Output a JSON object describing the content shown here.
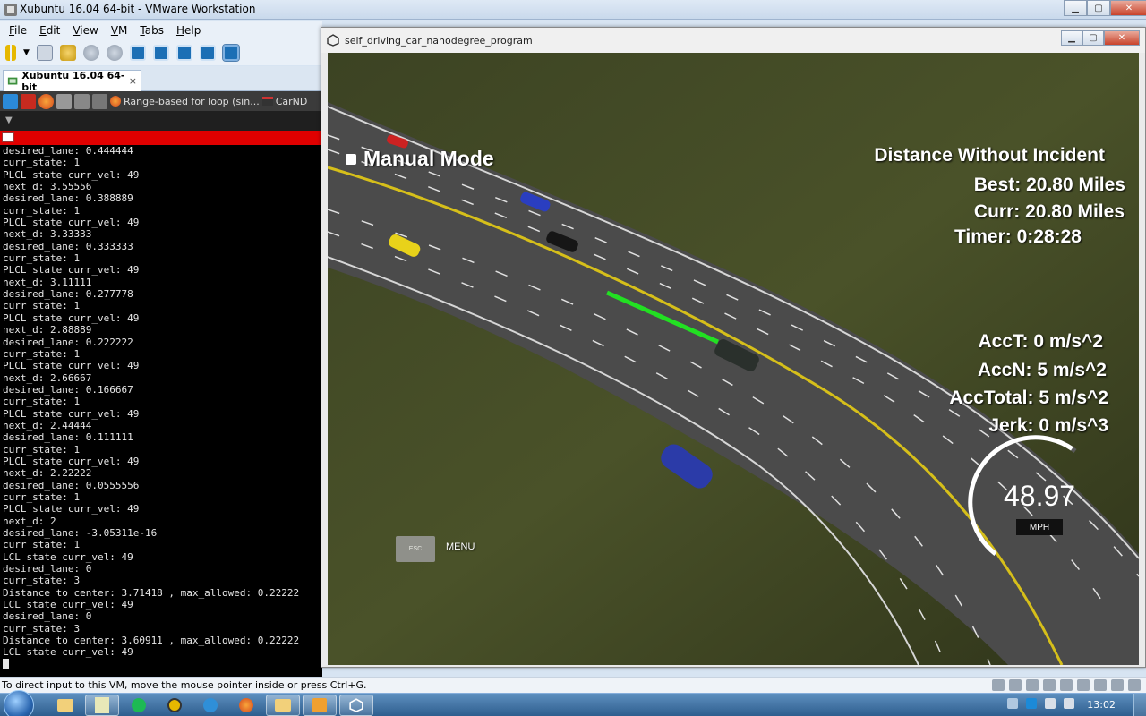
{
  "vmware": {
    "title": "Xubuntu 16.04 64-bit - VMware Workstation",
    "menu": [
      "File",
      "Edit",
      "View",
      "VM",
      "Tabs",
      "Help"
    ],
    "tab_label": "Xubuntu 16.04 64-bit",
    "tab_close": "×",
    "status_hint": "To direct input to this VM, move the mouse pointer inside or press Ctrl+G."
  },
  "guest_panel": {
    "tasks": [
      "Range-based for loop (sin...",
      "CarND"
    ]
  },
  "terminal": {
    "lines": [
      "desired_lane: 0.444444",
      "curr_state: 1",
      "PLCL state curr_vel: 49",
      "next_d: 3.55556",
      "desired_lane: 0.388889",
      "curr_state: 1",
      "PLCL state curr_vel: 49",
      "next_d: 3.33333",
      "desired_lane: 0.333333",
      "curr_state: 1",
      "PLCL state curr_vel: 49",
      "next_d: 3.11111",
      "desired_lane: 0.277778",
      "curr_state: 1",
      "PLCL state curr_vel: 49",
      "next_d: 2.88889",
      "desired_lane: 0.222222",
      "curr_state: 1",
      "PLCL state curr_vel: 49",
      "next_d: 2.66667",
      "desired_lane: 0.166667",
      "curr_state: 1",
      "PLCL state curr_vel: 49",
      "next_d: 2.44444",
      "desired_lane: 0.111111",
      "curr_state: 1",
      "PLCL state curr_vel: 49",
      "next_d: 2.22222",
      "desired_lane: 0.0555556",
      "curr_state: 1",
      "PLCL state curr_vel: 49",
      "next_d: 2",
      "desired_lane: -3.05311e-16",
      "curr_state: 1",
      "LCL state curr_vel: 49",
      "desired_lane: 0",
      "curr_state: 3",
      "Distance to center: 3.71418 , max_allowed: 0.22222",
      "LCL state curr_vel: 49",
      "desired_lane: 0",
      "curr_state: 3",
      "Distance to center: 3.60911 , max_allowed: 0.22222",
      "LCL state curr_vel: 49"
    ]
  },
  "simulator": {
    "title": "self_driving_car_nanodegree_program",
    "manual_mode": "Manual Mode",
    "distance_title": "Distance Without Incident",
    "best": "Best: 20.80 Miles",
    "curr": "Curr: 20.80 Miles",
    "timer": "Timer: 0:28:28",
    "acc_t": "AccT: 0 m/s^2",
    "acc_n": "AccN: 5 m/s^2",
    "acc_total": "AccTotal: 5 m/s^2",
    "jerk": "Jerk: 0 m/s^3",
    "speed": "48.97",
    "speed_unit": "MPH",
    "speed_fraction": 0.98,
    "esc_key": "ESC",
    "menu_label": "MENU",
    "colors": {
      "grass": "#3a3f22",
      "road": "#4a4a4a",
      "yellow_line": "#d8c21a",
      "planned_path": "#22e022"
    }
  },
  "taskbar": {
    "clock": "13:02"
  }
}
